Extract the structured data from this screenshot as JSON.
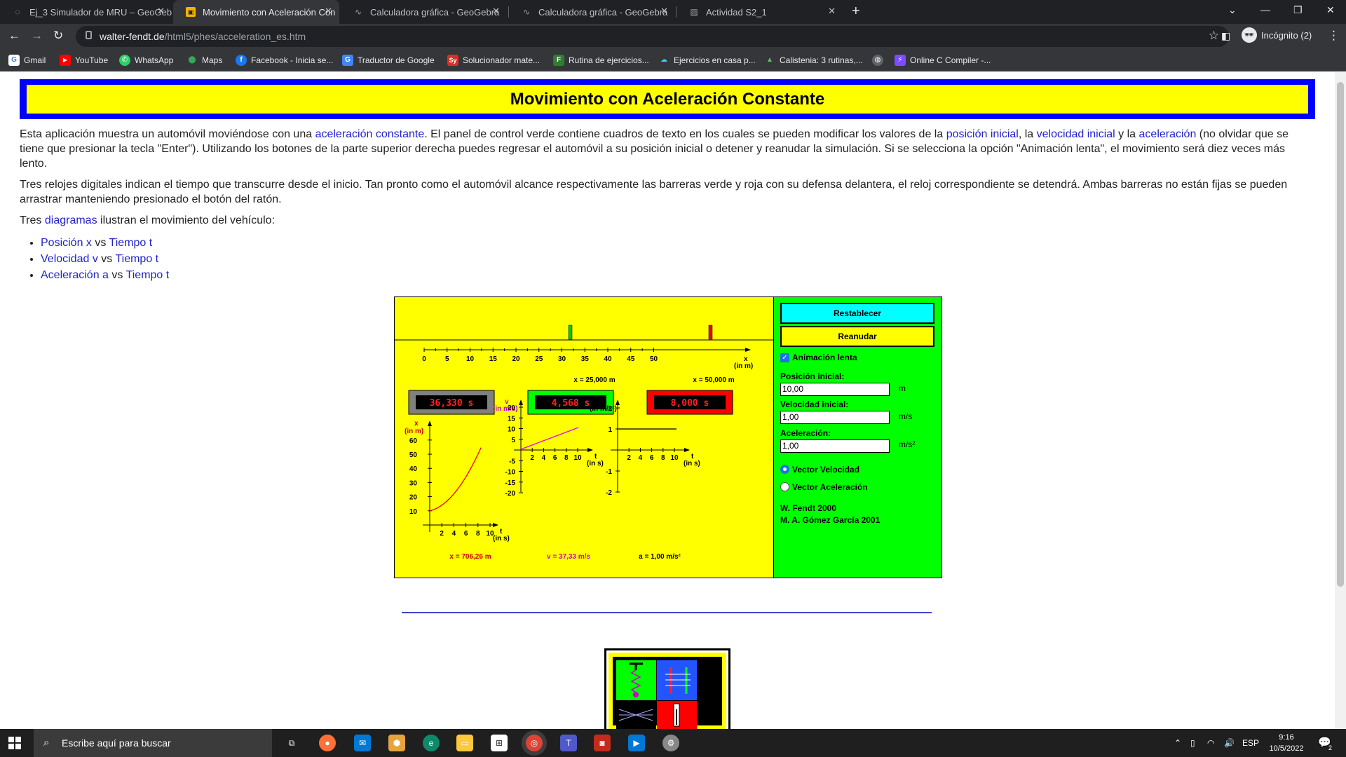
{
  "browser": {
    "tabs": [
      {
        "title": "Ej_3 Simulador de MRU – GeoGebra",
        "icon": "geogebra-loading-icon"
      },
      {
        "title": "Movimiento con Aceleración Con",
        "icon": "walter-fendt-icon"
      },
      {
        "title": "Calculadora gráfica - GeoGebra",
        "icon": "geogebra-graph-icon"
      },
      {
        "title": "Calculadora gráfica - GeoGebra",
        "icon": "geogebra-graph-icon"
      },
      {
        "title": "Actividad S2_1",
        "icon": "image-doc-icon"
      }
    ],
    "url_domain": "walter-fendt.de",
    "url_path": "/html5/phes/acceleration_es.htm",
    "profile_label": "Incógnito (2)",
    "bookmarks": [
      "Gmail",
      "YouTube",
      "WhatsApp",
      "Maps",
      "Facebook - Inicia se...",
      "Traductor de Google",
      "Solucionador mate...",
      "Rutina de ejercicios...",
      "Ejercicios en casa p...",
      "Calistenia: 3 rutinas,...",
      "",
      "Online C Compiler -..."
    ]
  },
  "page": {
    "title": "Movimiento con Aceleración Constante",
    "p1": {
      "a": "Esta aplicación muestra un automóvil moviéndose con una ",
      "l1": "aceleración constante",
      "b": ". El panel de control verde contiene cuadros de texto en los cuales se pueden modificar los valores de la ",
      "l2": "posición inicial",
      "c": ", la ",
      "l3": "velocidad inicial",
      "d": " y la ",
      "l4": "aceleración",
      "e": " (no olvidar que se tiene que presionar la tecla \"Enter\"). Utilizando los botones de la parte superior derecha puedes regresar el automóvil a su posición inicial o detener y reanudar la simulación. Si se selecciona la opción \"Animación lenta\", el movimiento será diez veces más lento."
    },
    "p2": "Tres relojes digitales indican el tiempo que transcurre desde el inicio. Tan pronto como el automóvil alcance respectivamente las barreras verde y roja con su defensa delantera, el reloj correspondiente se detendrá. Ambas barreras no están fijas se pueden arrastrar manteniendo presionado el botón del ratón.",
    "p3": {
      "a": "Tres ",
      "l": "diagramas",
      "b": " ilustran el movimiento del vehículo:"
    },
    "list": [
      {
        "l1": "Posición x",
        "m": " vs ",
        "l2": "Tiempo t"
      },
      {
        "l1": "Velocidad v",
        "m": " vs ",
        "l2": "Tiempo t"
      },
      {
        "l1": "Aceleración a",
        "m": " vs ",
        "l2": "Tiempo t"
      }
    ]
  },
  "sim": {
    "axis_ticks": [
      "0",
      "5",
      "10",
      "15",
      "20",
      "25",
      "30",
      "35",
      "40",
      "45",
      "50"
    ],
    "axis_label": "x",
    "axis_unit": "(in m)",
    "barrier_green_label": "x = 25,000 m",
    "barrier_red_label": "x = 50,000 m",
    "clock1": "36,330 s",
    "clock2": "4,568 s",
    "clock3": "8,000 s",
    "graph_x": {
      "ylabel": "x",
      "yunit": "(in m)",
      "yticks": [
        "60",
        "50",
        "40",
        "30",
        "20",
        "10"
      ],
      "xticks": [
        "2",
        "4",
        "6",
        "8",
        "10"
      ],
      "tlabel": "t",
      "tunit": "(in s)",
      "readout": "x = 706,26 m"
    },
    "graph_v": {
      "ylabel": "v",
      "yunit": "(in m/s)",
      "yticks": [
        "20",
        "15",
        "10",
        "5",
        "-5",
        "-10",
        "-15",
        "-20"
      ],
      "xticks": [
        "2",
        "4",
        "6",
        "8",
        "10"
      ],
      "tlabel": "t",
      "tunit": "(in s)",
      "readout": "v = 37,33 m/s"
    },
    "graph_a": {
      "ylabel": "a",
      "yunit": "(in m/s²)",
      "yticks": [
        "2",
        "1",
        "-1",
        "-2"
      ],
      "xticks": [
        "2",
        "4",
        "6",
        "8",
        "10"
      ],
      "tlabel": "t",
      "tunit": "(in s)",
      "readout": "a = 1,00 m/s²"
    }
  },
  "controls": {
    "reset": "Restablecer",
    "resume": "Reanudar",
    "slow": "Animación lenta",
    "pos_label": "Posición inicial:",
    "pos_value": "10,00",
    "pos_unit": "m",
    "vel_label": "Velocidad inicial:",
    "vel_value": "1,00",
    "vel_unit": "m/s",
    "acc_label": "Aceleración:",
    "acc_value": "1,00",
    "acc_unit": "m/s²",
    "radio1": "Vector Velocidad",
    "radio2": "Vector Aceleración",
    "credit1": "W. Fendt 2000",
    "credit2": "M. A. Gómez García 2001"
  },
  "taskbar": {
    "search_placeholder": "Escribe aquí para buscar",
    "lang": "ESP",
    "time": "9:16",
    "date": "10/5/2022",
    "notif_count": "2"
  }
}
